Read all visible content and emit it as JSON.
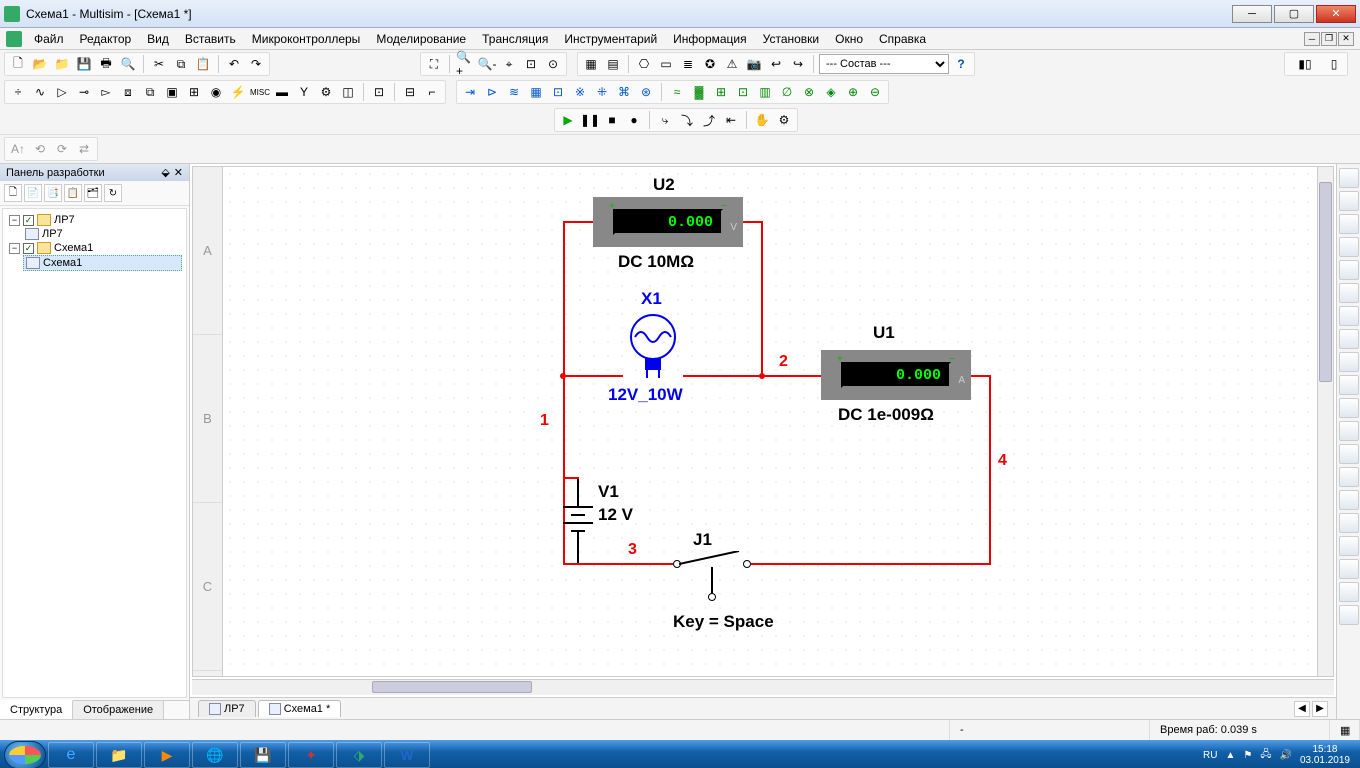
{
  "window": {
    "title": "Схема1 - Multisim - [Схема1 *]"
  },
  "menu": [
    "Файл",
    "Редактор",
    "Вид",
    "Вставить",
    "Микроконтроллеры",
    "Моделирование",
    "Трансляция",
    "Инструментарий",
    "Информация",
    "Установки",
    "Окно",
    "Справка"
  ],
  "combo_state": "--- Состав ---",
  "panel": {
    "title": "Панель разработки",
    "tree": {
      "root1": "ЛР7",
      "child1": "ЛР7",
      "root2": "Схема1",
      "child2": "Схема1"
    },
    "tabs": {
      "t1": "Структура",
      "t2": "Отображение"
    }
  },
  "doc_tabs": {
    "t1": "ЛР7",
    "t2": "Схема1 *"
  },
  "row_labels": [
    "A",
    "B",
    "C"
  ],
  "status": {
    "dash": "-",
    "timing": "Время раб: 0.039 s"
  },
  "taskbar": {
    "lang": "RU",
    "time": "15:18",
    "date": "03.01.2019"
  },
  "circuit": {
    "u2": {
      "name": "U2",
      "reading": "0.000",
      "desc": "DC  10MΩ"
    },
    "u1": {
      "name": "U1",
      "reading": "0.000",
      "desc": "DC  1e-009Ω"
    },
    "x1": {
      "name": "X1",
      "desc": "12V_10W"
    },
    "v1": {
      "name": "V1",
      "value": "12 V"
    },
    "j1": {
      "name": "J1",
      "key": "Key = Space"
    },
    "nets": {
      "n1": "1",
      "n2": "2",
      "n3": "3",
      "n4": "4"
    }
  }
}
